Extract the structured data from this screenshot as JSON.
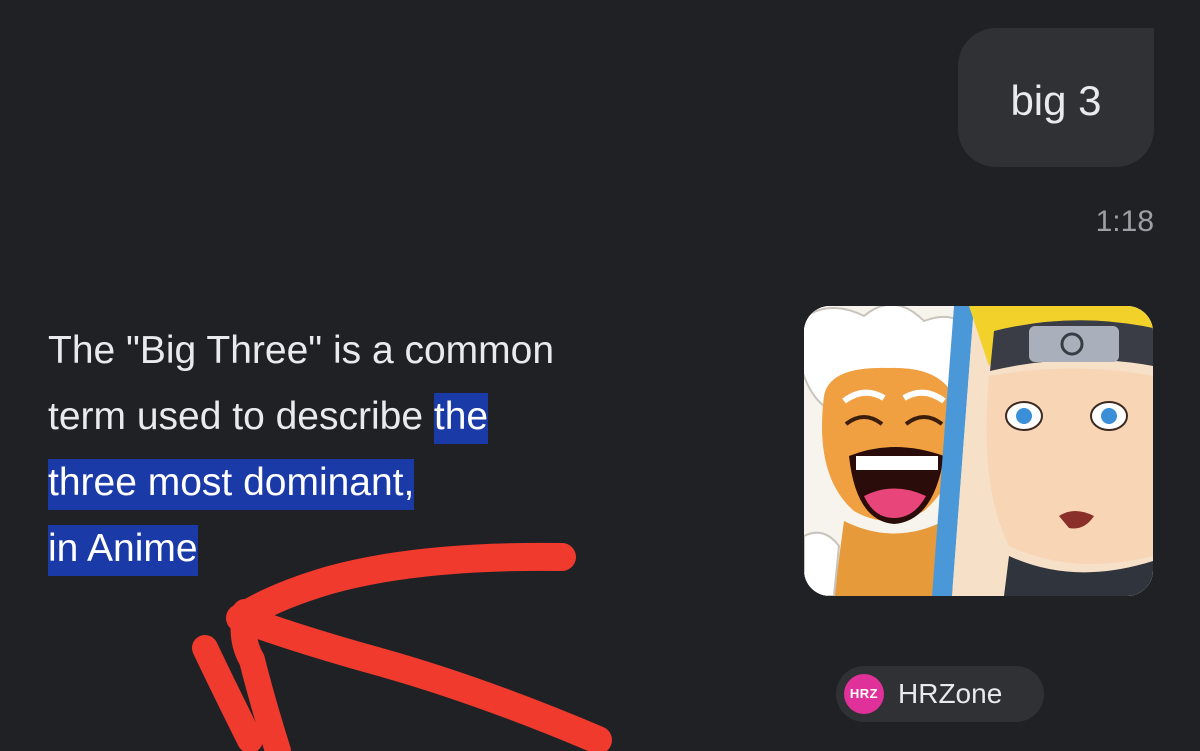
{
  "conversation": {
    "user_message": "big 3",
    "timestamp": "1:18",
    "answer": {
      "line1": "The \"Big Three\" is a common",
      "line2_plain": "term used to describe ",
      "line2_highlight": "the",
      "line3_highlight": "three most dominant,",
      "line4_highlight": "in Anime"
    },
    "source": {
      "logo_text": "HRZ",
      "name": "HRZone"
    },
    "thumbnail_icon": "anime-characters-image"
  },
  "colors": {
    "background": "#202124",
    "bubble": "#303134",
    "highlight": "#1a3aa8",
    "annotation": "#f03a2e",
    "source_logo": "#e0309a"
  }
}
